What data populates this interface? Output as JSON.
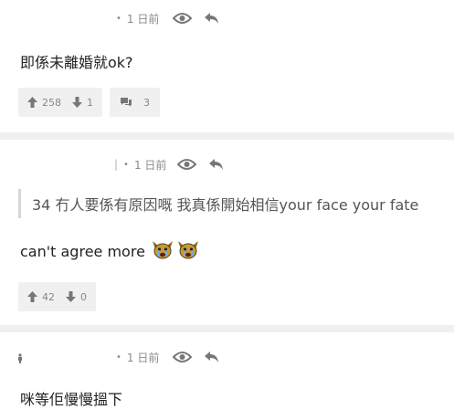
{
  "posts": [
    {
      "time": "1 日前",
      "body": "即係未離婚就ok?",
      "upvotes": "258",
      "downvotes": "1",
      "comments": "3"
    },
    {
      "time": "1 日前",
      "quote": "34 冇人要係有原因嘅 我真係開始相信your face your fate",
      "body": "can't agree more",
      "upvotes": "42",
      "downvotes": "0"
    },
    {
      "time": "1 日前",
      "body": "咪等佢慢慢搵下"
    }
  ],
  "meta": {
    "dot": "•",
    "pipe": "|"
  },
  "icons": {
    "view": "eye-icon",
    "reply": "reply-arrow-icon",
    "upvote": "thumb-up-icon",
    "downvote": "thumb-down-icon",
    "comment": "speech-bubbles-icon",
    "emoji": "crying-dog-emoji-icon",
    "avatar": "person-icon"
  },
  "colors": {
    "meta_text": "#8a8a8a",
    "divider": "#f0f0f0",
    "button_bg": "#f0f0f0"
  }
}
